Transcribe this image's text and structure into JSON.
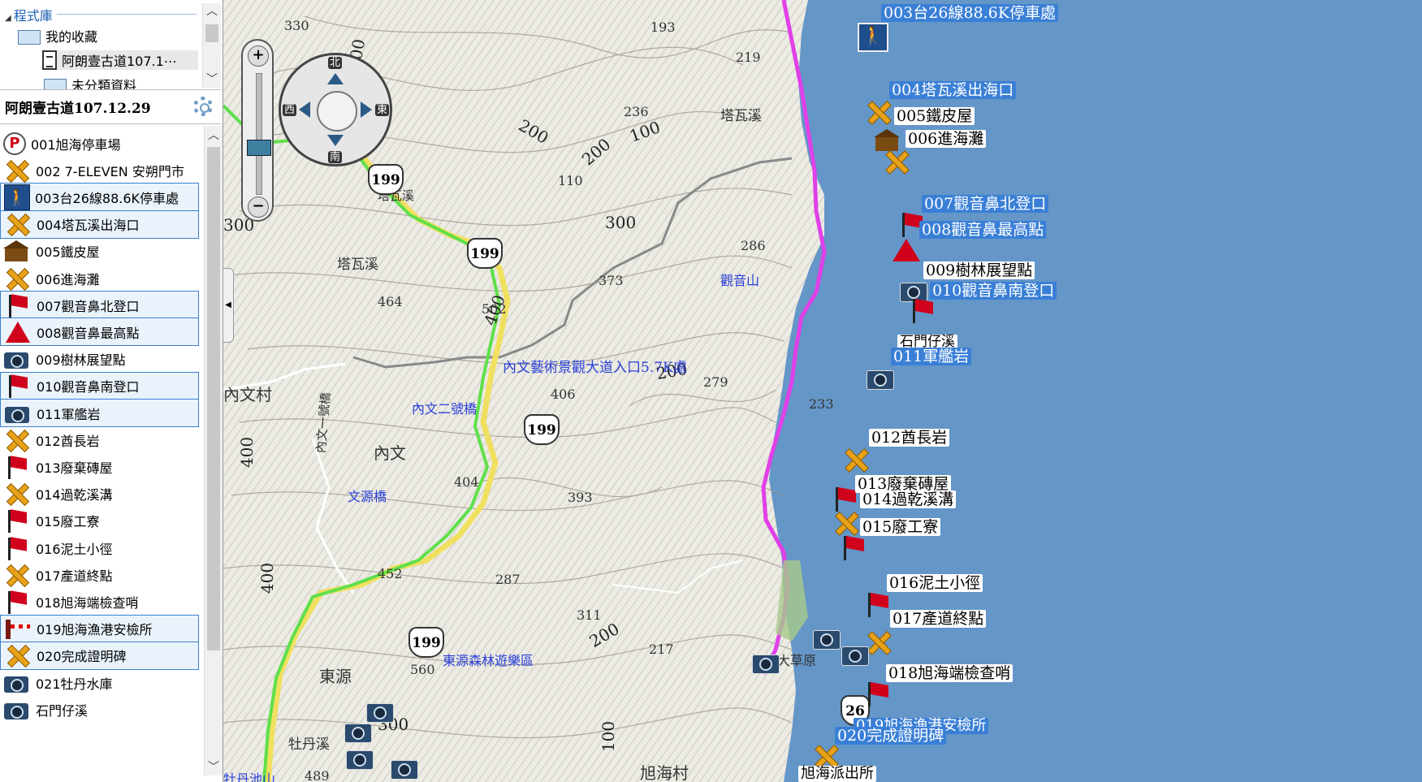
{
  "library": {
    "header": "程式庫",
    "items": [
      {
        "label": "我的收藏",
        "icon": "folder-icon"
      },
      {
        "label": "阿朗壹古道107.1⋯",
        "icon": "document-icon"
      },
      {
        "label": "未分類資料",
        "icon": "folder-icon"
      }
    ]
  },
  "track": {
    "title": "阿朗壹古道107.12.29"
  },
  "waypoints": [
    {
      "label": "001旭海停車場",
      "icon": "parking-icon",
      "selected": false
    },
    {
      "label": "002 7-ELEVEN 安朔門市",
      "icon": "crossed-tools-icon",
      "selected": false
    },
    {
      "label": "003台26線88.6K停車處",
      "icon": "hiker-icon",
      "selected": true
    },
    {
      "label": "004塔瓦溪出海口",
      "icon": "crossed-tools-icon",
      "selected": true
    },
    {
      "label": "005鐵皮屋",
      "icon": "house-icon",
      "selected": false
    },
    {
      "label": "006進海灘",
      "icon": "crossed-tools-icon",
      "selected": false
    },
    {
      "label": "007觀音鼻北登口",
      "icon": "red-flag-icon",
      "selected": true
    },
    {
      "label": "008觀音鼻最高點",
      "icon": "red-triangle-icon",
      "selected": true
    },
    {
      "label": "009樹林展望點",
      "icon": "camera-icon",
      "selected": false
    },
    {
      "label": "010觀音鼻南登口",
      "icon": "red-flag-icon",
      "selected": true
    },
    {
      "label": "011軍艦岩",
      "icon": "camera-icon",
      "selected": true
    },
    {
      "label": "012酋長岩",
      "icon": "crossed-tools-icon",
      "selected": false
    },
    {
      "label": "013廢棄磚屋",
      "icon": "red-flag-icon",
      "selected": false
    },
    {
      "label": "014過乾溪溝",
      "icon": "crossed-tools-icon",
      "selected": false
    },
    {
      "label": "015廢工寮",
      "icon": "red-flag-icon",
      "selected": false
    },
    {
      "label": "016泥土小徑",
      "icon": "red-flag-icon",
      "selected": false
    },
    {
      "label": "017產道終點",
      "icon": "crossed-tools-icon",
      "selected": false
    },
    {
      "label": "018旭海端檢查哨",
      "icon": "red-flag-icon",
      "selected": false
    },
    {
      "label": "019旭海漁港安檢所",
      "icon": "gate-icon",
      "selected": true
    },
    {
      "label": "020完成證明碑",
      "icon": "crossed-tools-icon",
      "selected": true
    },
    {
      "label": "021牡丹水庫",
      "icon": "camera-icon",
      "selected": false
    },
    {
      "label": "石門仔溪",
      "icon": "camera-icon",
      "selected": false
    }
  ],
  "map": {
    "compass": {
      "north": "北",
      "south": "南",
      "east": "東",
      "west": "西"
    },
    "zoom": {
      "plus": "+",
      "minus": "−"
    },
    "colors": {
      "sea": "#6496c8",
      "track_green": "#5fe04a",
      "road_yellow": "#f0e060",
      "coast_route": "#e040e8",
      "label_blue": "#3a7fd6"
    },
    "waypoint_labels": [
      {
        "text": "003台26線88.6K停車處",
        "style": "blue"
      },
      {
        "text": "004塔瓦溪出海口",
        "style": "blue"
      },
      {
        "text": "005鐵皮屋",
        "style": "white"
      },
      {
        "text": "006進海灘",
        "style": "white"
      },
      {
        "text": "007觀音鼻北登口",
        "style": "blue"
      },
      {
        "text": "008觀音鼻最高點",
        "style": "blue"
      },
      {
        "text": "009樹林展望點",
        "style": "white"
      },
      {
        "text": "010觀音鼻南登口",
        "style": "blue"
      },
      {
        "text": "石門仔溪",
        "style": "white"
      },
      {
        "text": "011軍艦岩",
        "style": "blue"
      },
      {
        "text": "012酋長岩",
        "style": "white"
      },
      {
        "text": "013廢棄磚屋",
        "style": "white"
      },
      {
        "text": "014過乾溪溝",
        "style": "white"
      },
      {
        "text": "015廢工寮",
        "style": "white"
      },
      {
        "text": "016泥土小徑",
        "style": "white"
      },
      {
        "text": "017產道終點",
        "style": "white"
      },
      {
        "text": "018旭海端檢查哨",
        "style": "white"
      },
      {
        "text": "019旭海漁港安檢所",
        "style": "blue"
      },
      {
        "text": "020完成證明碑",
        "style": "blue"
      },
      {
        "text": "旭海派出所",
        "style": "white"
      }
    ],
    "elevations": [
      "330",
      "193",
      "219",
      "236",
      "110",
      "286",
      "373",
      "464",
      "502",
      "406",
      "279",
      "233",
      "404",
      "393",
      "452",
      "287",
      "311",
      "217",
      "560",
      "489"
    ],
    "contour_labels": [
      "300",
      "200",
      "100",
      "300",
      "400",
      "300",
      "200",
      "400",
      "400",
      "200",
      "100",
      "300",
      "200",
      "100"
    ],
    "places": [
      "塔瓦溪",
      "塔瓦溪",
      "塔瓦溪",
      "內文",
      "內文村",
      "東源",
      "牡丹溪",
      "旭海村",
      "內文一號橋"
    ],
    "blue_labels": [
      "內文藝術景觀大道入口5.7K處",
      "內文二號橋",
      "文源橋",
      "東源森林遊樂區",
      "觀音山",
      "牡丹池山",
      "旭海大草原"
    ],
    "highways": [
      "199",
      "199",
      "199",
      "199",
      "26"
    ]
  }
}
